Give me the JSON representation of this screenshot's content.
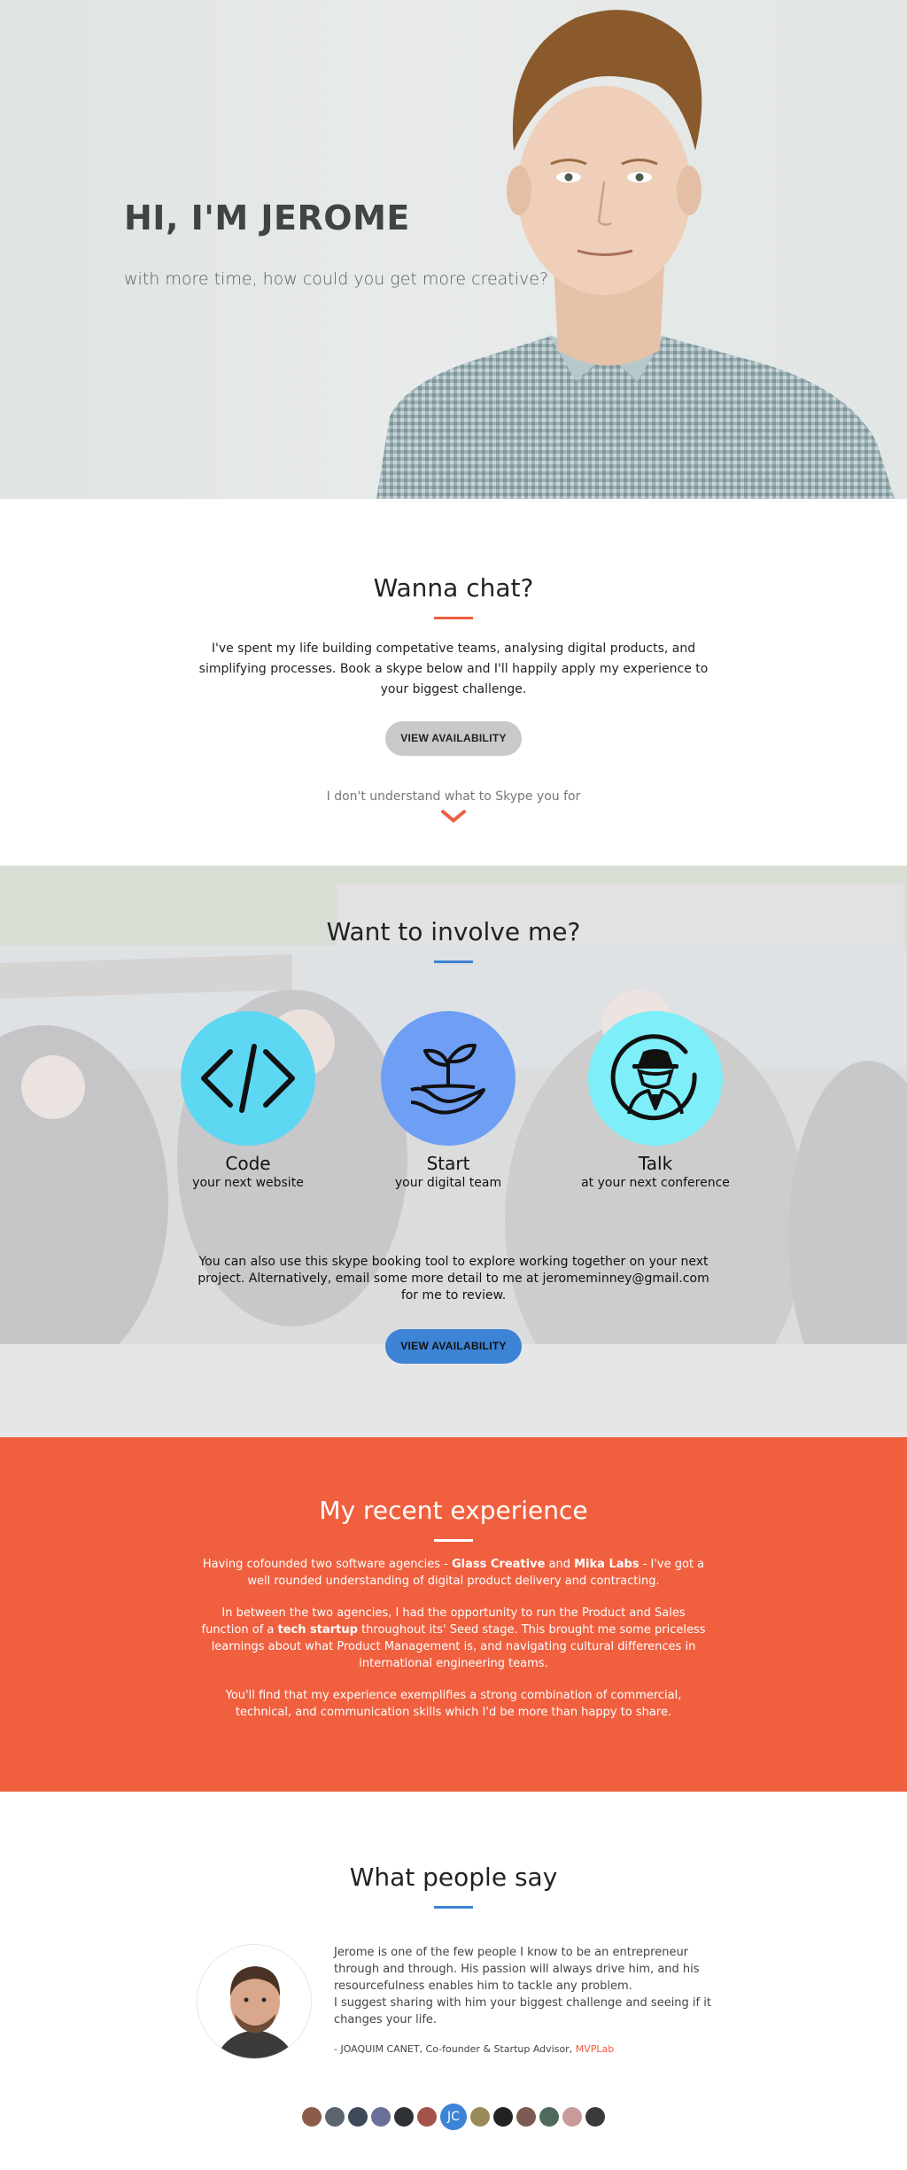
{
  "hero": {
    "title": "HI, I'M JEROME",
    "subtitle": "with more time, how could you get more creative?"
  },
  "chat": {
    "title": "Wanna chat?",
    "lead": "I've spent my life building competative teams, analysing digital products, and simplifying processes. Book a skype below and I'll happily apply my experience to your biggest challenge.",
    "button": "VIEW AVAILABILITY",
    "hint": "I don't understand what to Skype you for"
  },
  "involve": {
    "title": "Want to involve me?",
    "services": [
      {
        "name": "Code",
        "sub": "your next website",
        "icon": "code-icon",
        "color": "#5dd7f2"
      },
      {
        "name": "Start",
        "sub": "your digital team",
        "icon": "seedling-hand-icon",
        "color": "#6f9ff5"
      },
      {
        "name": "Talk",
        "sub": "at your next conference",
        "icon": "spy-person-icon",
        "color": "#7eeef8"
      }
    ],
    "note": "You can also use this skype booking tool to explore working together on your next project. Alternatively, email some more detail to me at jeromeminney@gmail.com for me to review.",
    "button": "VIEW AVAILABILITY"
  },
  "experience": {
    "title": "My recent experience",
    "p1_a": "Having cofounded two software agencies - ",
    "p1_b": "Glass Creative",
    "p1_c": " and ",
    "p1_d": "Mika Labs",
    "p1_e": " - I've got a well rounded understanding of digital product delivery and contracting.",
    "p2_a": "In between the two agencies, I had the opportunity to run the Product and Sales function of a ",
    "p2_b": "tech startup",
    "p2_c": " throughout its' Seed stage. This brought me some priceless learnings about what Product Management is, and navigating cultural differences in international engineering teams.",
    "p3": "You'll find that my experience exemplifies a strong combination of commercial, technical, and communication skills which I'd be more than happy to share."
  },
  "people": {
    "title": "What people say",
    "quote_1": "Jerome is one of the few people I know to be an entrepreneur through and through. His passion will always drive him, and his resourcefulness enables him to tackle any problem.",
    "quote_2": "I suggest sharing with him your biggest challenge and seeing if it changes your life.",
    "author": "- JOAQUIM CANET, Co-founder & Startup Advisor, ",
    "company": "MVPLab",
    "active_initials": "JC"
  },
  "colors": {
    "accent_orange": "#f0603f",
    "accent_blue": "#3d83d6"
  }
}
